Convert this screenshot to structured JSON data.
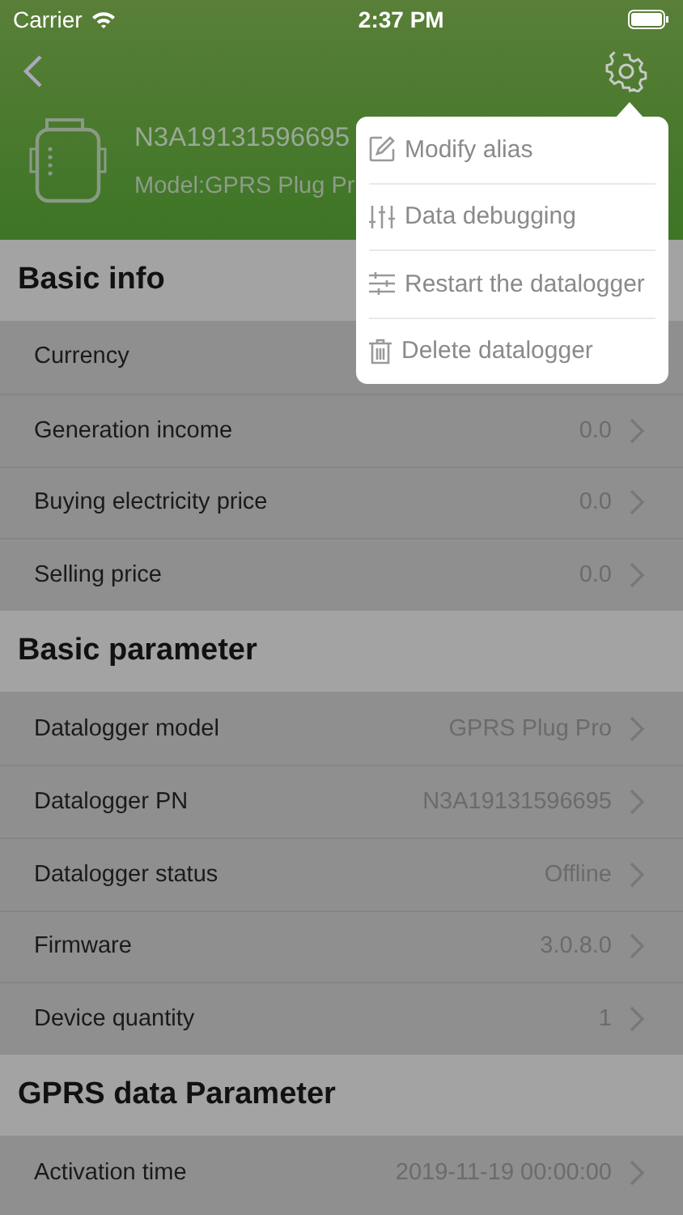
{
  "status_bar": {
    "carrier": "Carrier",
    "time": "2:37 PM"
  },
  "device": {
    "name": "N3A19131596695",
    "model": "Model:GPRS Plug Pr"
  },
  "menu": [
    {
      "kind": "edit",
      "label": "Modify alias"
    },
    {
      "kind": "sliders",
      "label": "Data debugging"
    },
    {
      "kind": "lines",
      "label": "Restart the datalogger"
    },
    {
      "kind": "trash",
      "label": "Delete datalogger"
    }
  ],
  "sections": [
    {
      "title": "Basic info",
      "rows": [
        {
          "label": "Currency"
        },
        {
          "label": "Generation  income",
          "value": "0.0"
        },
        {
          "label": "Buying electricity price",
          "value": "0.0"
        },
        {
          "label": "Selling price",
          "value": "0.0"
        }
      ]
    },
    {
      "title": "Basic parameter",
      "rows": [
        {
          "label": "Datalogger model",
          "value": "GPRS Plug Pro"
        },
        {
          "label": "Datalogger PN",
          "value": "N3A19131596695"
        },
        {
          "label": "Datalogger status",
          "value": "Offline"
        },
        {
          "label": "Firmware",
          "value": "3.0.8.0"
        },
        {
          "label": "Device quantity",
          "value": "1"
        }
      ]
    },
    {
      "title": "GPRS data Parameter",
      "rows": [
        {
          "label": "Activation time",
          "value": "2019-11-19 00:00:00"
        }
      ]
    }
  ]
}
